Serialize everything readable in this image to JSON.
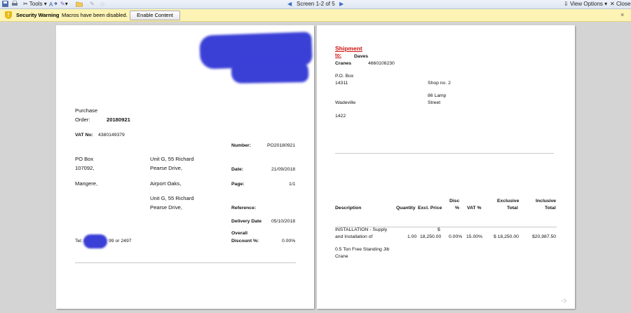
{
  "toolbar": {
    "tools_label": "Tools",
    "screen_label": "Screen 1-2 of 5",
    "view_options": "View Options",
    "close_label": "Close"
  },
  "security_bar": {
    "title": "Security Warning",
    "message": "Macros have been disabled.",
    "button": "Enable Content",
    "close": "×"
  },
  "page1": {
    "po_label": "Purchase",
    "po_label2": "Order:",
    "po_number": "20180921",
    "vat_label": "VAT No:",
    "vat_value": "4380149379",
    "number_label": "Number:",
    "number_value": "PO20180921",
    "addr1_line1": "PO Box",
    "addr1_line2": "107092,",
    "addr1_line3": "Mangere,",
    "addr2_line1": "Unit G, 55 Richard",
    "addr2_line2": "Pearse Drive,",
    "addr2_line3": "Airport Oaks,",
    "addr2_line4": "Unit G, 55 Richard",
    "addr2_line5": "Pearse Drive,",
    "date_label": "Date:",
    "date_value": "21/09/2018",
    "page_label": "Page:",
    "page_value": "1/1",
    "reference_label": "Reference:",
    "delivery_label": "Delivery Date",
    "delivery_value": "05/10/2018",
    "discount_label1": "Overall",
    "discount_label2": "Discount %:",
    "discount_value": "0.00%",
    "tel_prefix": "Tel: 01",
    "tel_suffix": "99 or 2497"
  },
  "page2": {
    "shipment_label1": "Shipment",
    "shipment_label2": "to:",
    "ship_name1": "Daves",
    "ship_name2": "Cranes",
    "ship_phone": "4660108230",
    "box1": "P.O. Box",
    "box2": "14311",
    "shop": "Shop no. 2",
    "street1": "86 Lamp",
    "street2": "Street",
    "town": "Wadeville",
    "postcode": "1422",
    "headers": {
      "description": "Description",
      "quantity": "Quantity",
      "excl_price": "Excl. Price",
      "disc1": "Disc",
      "disc2": "%",
      "vat": "VAT %",
      "exclusive1": "Exclusive",
      "exclusive2": "Total",
      "inclusive1": "Inclusive",
      "inclusive2": "Total"
    },
    "row": {
      "desc1": "INSTALLATION - Supply",
      "desc2": "and Installation of",
      "desc3": "0.5 Ton Free Standing Jib",
      "desc4": "Crane",
      "quantity": "1.00",
      "price_symbol": "$",
      "excl_price": "18,250.00",
      "disc": "0.00%",
      "vat": "15.00%",
      "exclusive": "$ 18,250.00",
      "inclusive": "$20,987.50"
    }
  }
}
